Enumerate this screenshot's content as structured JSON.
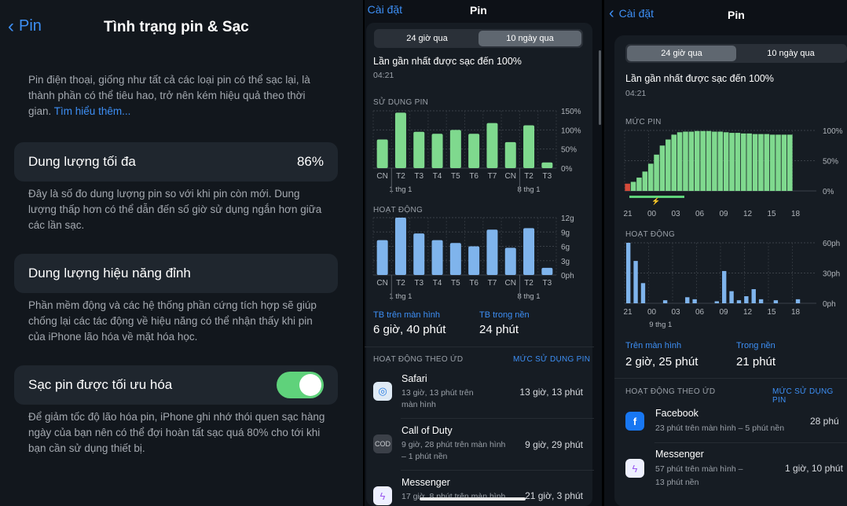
{
  "panel1": {
    "back_label": "Pin",
    "title": "Tình trạng pin & Sạc",
    "intro": "Pin điện thoại, giống như tất cả các loại pin có thể sạc lại, là thành phần có thể tiêu hao, trở nên kém hiệu quả theo thời gian.",
    "learn_more": "Tìm hiểu thêm...",
    "max_capacity_label": "Dung lượng tối đa",
    "max_capacity_value": "86%",
    "max_capacity_desc": "Đây là số đo dung lượng pin so với khi pin còn mới. Dung lượng thấp hơn có thể dẫn đến số giờ sử dụng ngắn hơn giữa các lần sạc.",
    "peak_label": "Dung lượng hiệu năng đỉnh",
    "peak_desc": "Phần mềm động và các hệ thống phần cứng tích hợp sẽ giúp chống lại các tác động về hiệu năng có thể nhận thấy khi pin của iPhone lão hóa về mặt hóa học.",
    "optimized_label": "Sạc pin được tối ưu hóa",
    "optimized_on": true,
    "optimized_desc": "Để giảm tốc độ lão hóa pin, iPhone ghi nhớ thói quen sạc hàng ngày của bạn nên có thể đợi hoàn tất sạc quá 80% cho tới khi bạn cần sử dụng thiết bị."
  },
  "panel2": {
    "back_label": "Cài đặt",
    "title": "Pin",
    "seg": [
      "24 giờ qua",
      "10 ngày qua"
    ],
    "seg_active": 1,
    "last_charged": "Lần gần nhất được sạc đến 100%",
    "last_time": "04:21",
    "usage_title": "SỬ DỤNG PIN",
    "activity_title": "HOẠT ĐỘNG",
    "avg_screen_label": "TB trên màn hình",
    "avg_screen_value": "6 giờ, 40 phút",
    "avg_bg_label": "TB trong nền",
    "avg_bg_value": "24 phút",
    "by_app": "HOẠT ĐỘNG THEO ỨD",
    "usage_link": "MỨC SỬ DỤNG PIN",
    "apps": [
      {
        "name": "Safari",
        "sub1": "13 giờ, 13 phút trên",
        "sub2": "màn hình",
        "value": "13 giờ, 13 phút",
        "icon": "safari-icon"
      },
      {
        "name": "Call of Duty",
        "sub1": "9 giờ, 28 phút trên màn hình",
        "sub2": "– 1 phút nền",
        "value": "9 giờ, 29 phút",
        "icon": "call-of-duty-icon"
      },
      {
        "name": "Messenger",
        "sub1": "17 giờ, 8 phút trên màn hình",
        "sub2": "",
        "value": "21 giờ, 3 phút",
        "icon": "messenger-icon"
      }
    ]
  },
  "panel3": {
    "back_label": "Cài đặt",
    "title": "Pin",
    "seg": [
      "24 giờ qua",
      "10 ngày qua"
    ],
    "seg_active": 0,
    "last_charged": "Lần gần nhất được sạc đến 100%",
    "last_time": "04:21",
    "level_title": "MỨC PIN",
    "activity_title": "HOẠT ĐỘNG",
    "screen_label": "Trên màn hình",
    "screen_value": "2 giờ, 25 phút",
    "bg_label": "Trong nền",
    "bg_value": "21 phút",
    "by_app": "HOẠT ĐỘNG THEO ỨD",
    "usage_link": "MỨC SỬ DỤNG PIN",
    "apps": [
      {
        "name": "Facebook",
        "sub1": "23 phút trên màn hình – 5 phút nền",
        "sub2": "",
        "value": "28 phú",
        "icon": "facebook-icon"
      },
      {
        "name": "Messenger",
        "sub1": "57 phút trên màn hình –",
        "sub2": "13 phút nền",
        "value": "1 giờ, 10 phút",
        "icon": "messenger-icon"
      }
    ]
  },
  "chart_data": [
    {
      "type": "bar",
      "title": "SỬ DỤNG PIN",
      "categories": [
        "CN",
        "T2",
        "T3",
        "T4",
        "T5",
        "T6",
        "T7",
        "CN",
        "T2",
        "T3"
      ],
      "date_labels": [
        "1 thg 1",
        "8 thg 1"
      ],
      "values": [
        75,
        145,
        95,
        90,
        100,
        90,
        118,
        68,
        112,
        15
      ],
      "ylim": [
        0,
        150
      ],
      "yticks": [
        "0%",
        "50%",
        "100%",
        "150%"
      ],
      "color": "#7fd98e"
    },
    {
      "type": "bar",
      "title": "HOẠT ĐỘNG",
      "categories": [
        "CN",
        "T2",
        "T3",
        "T4",
        "T5",
        "T6",
        "T7",
        "CN",
        "T2",
        "T3"
      ],
      "date_labels": [
        "1 thg 1",
        "8 thg 1"
      ],
      "values": [
        7.3,
        12,
        8.7,
        7.3,
        6.7,
        6,
        9.5,
        5.7,
        9.8,
        1.5
      ],
      "ylim": [
        0,
        12
      ],
      "yticks": [
        "0ph",
        "3g",
        "6g",
        "9g",
        "12g"
      ],
      "color": "#7fb4ec"
    },
    {
      "type": "area",
      "title": "MỨC PIN",
      "x_labels": [
        "21",
        "00",
        "03",
        "06",
        "09",
        "12",
        "15",
        "18"
      ],
      "values": [
        12,
        15,
        22,
        32,
        45,
        60,
        75,
        85,
        93,
        97,
        98,
        98,
        99,
        99,
        99,
        98,
        98,
        97,
        96,
        96,
        95,
        95,
        94,
        94,
        94,
        93,
        93,
        93,
        93
      ],
      "ylim": [
        0,
        100
      ],
      "yticks": [
        "0%",
        "50%",
        "100%"
      ],
      "color": "#7fd98e"
    },
    {
      "type": "bar",
      "title": "HOẠT ĐỘNG",
      "x_labels": [
        "21",
        "00",
        "03",
        "06",
        "09",
        "12",
        "15",
        "18"
      ],
      "date_label": "9 thg 1",
      "values": [
        60,
        42,
        20,
        0,
        0,
        3,
        0,
        0,
        6,
        4,
        0,
        0,
        2,
        32,
        12,
        3,
        7,
        14,
        4,
        0,
        3,
        0,
        0,
        4,
        0,
        0
      ],
      "ylim": [
        0,
        60
      ],
      "yticks": [
        "0ph",
        "30ph",
        "60ph"
      ],
      "color": "#7fb4ec"
    }
  ]
}
